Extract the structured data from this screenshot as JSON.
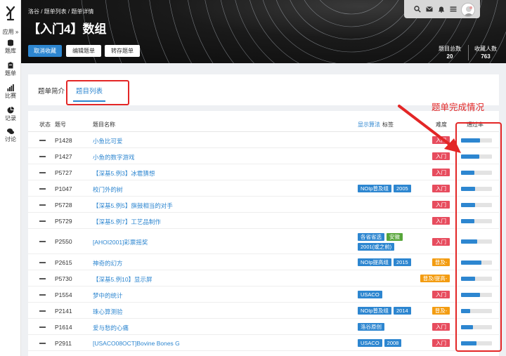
{
  "sidebar": {
    "app_label": "应用 »",
    "items": [
      {
        "icon": "database-icon",
        "label": "题库"
      },
      {
        "icon": "clipboard-icon",
        "label": "题单"
      },
      {
        "icon": "bar-chart-icon",
        "label": "比赛"
      },
      {
        "icon": "pie-chart-icon",
        "label": "记录"
      },
      {
        "icon": "chat-icon",
        "label": "讨论"
      }
    ]
  },
  "header": {
    "breadcrumb": "洛谷 / 题单列表 / 题单详情",
    "title": "【入门4】数组",
    "buttons": {
      "unfavorite": "取消收藏",
      "edit": "编辑题单",
      "save": "转存题单"
    },
    "stats": {
      "problem_count_label": "题目总数",
      "problem_count": "20",
      "favorites_label": "收藏人数",
      "favorites": "763"
    },
    "topbar_icons": [
      "search-icon",
      "mail-icon",
      "bell-icon",
      "menu-icon"
    ]
  },
  "tabs": [
    {
      "label": "题单简介"
    },
    {
      "label": "题目列表"
    }
  ],
  "table": {
    "headers": {
      "status": "状态",
      "pid": "题号",
      "name": "题目名称",
      "algo": "显示算法",
      "tags": "标签",
      "difficulty": "难度",
      "pass_rate": "通过率"
    },
    "rows": [
      {
        "pid": "P1428",
        "name": "小鱼比可爱",
        "tags": [],
        "difficulty": "入门",
        "rate": 0.62
      },
      {
        "pid": "P1427",
        "name": "小鱼的数字游戏",
        "tags": [],
        "difficulty": "入门",
        "rate": 0.6
      },
      {
        "pid": "P5727",
        "name": "【深基5.例3】冰雹猜想",
        "tags": [],
        "difficulty": "入门",
        "rate": 0.44
      },
      {
        "pid": "P1047",
        "name": "校门外的树",
        "tags": [
          "NOIp普及组",
          "2005"
        ],
        "difficulty": "入门",
        "rate": 0.45
      },
      {
        "pid": "P5728",
        "name": "【深基5.例5】旗鼓相当的对手",
        "tags": [],
        "difficulty": "入门",
        "rate": 0.45
      },
      {
        "pid": "P5729",
        "name": "【深基5.例7】工艺品制作",
        "tags": [],
        "difficulty": "入门",
        "rate": 0.43
      },
      {
        "pid": "P2550",
        "name": "[AHOI2001]彩票摇奖",
        "tags": [
          "各省省选",
          "安徽",
          "2001(或之前)"
        ],
        "difficulty": "入门",
        "rate": 0.52
      },
      {
        "pid": "P2615",
        "name": "神奇的幻方",
        "tags": [
          "NOIp提高组",
          "2015"
        ],
        "difficulty": "普及-",
        "rate": 0.66
      },
      {
        "pid": "P5730",
        "name": "【深基5.例10】显示屏",
        "tags": [],
        "difficulty": "普及/提高-",
        "rate": 0.46
      },
      {
        "pid": "P1554",
        "name": "梦中的统计",
        "tags": [
          "USACO"
        ],
        "difficulty": "入门",
        "rate": 0.62
      },
      {
        "pid": "P2141",
        "name": "珠心算测验",
        "tags": [
          "NOIp普及组",
          "2014"
        ],
        "difficulty": "普及-",
        "rate": 0.3
      },
      {
        "pid": "P1614",
        "name": "爱与愁的心痛",
        "tags": [
          "洛谷原创"
        ],
        "difficulty": "入门",
        "rate": 0.38
      },
      {
        "pid": "P2911",
        "name": "[USACO08OCT]Bovine Bones G",
        "tags": [
          "USACO",
          "2008"
        ],
        "difficulty": "入门",
        "rate": 0.5
      }
    ]
  },
  "annotation": {
    "text": "题单完成情况"
  },
  "colors": {
    "accent": "#2d86d0",
    "difficulty_entry": "#e74c5e",
    "difficulty_easy": "#f39c11",
    "tag_green": "#57a63a",
    "annotation_red": "#e32626"
  }
}
